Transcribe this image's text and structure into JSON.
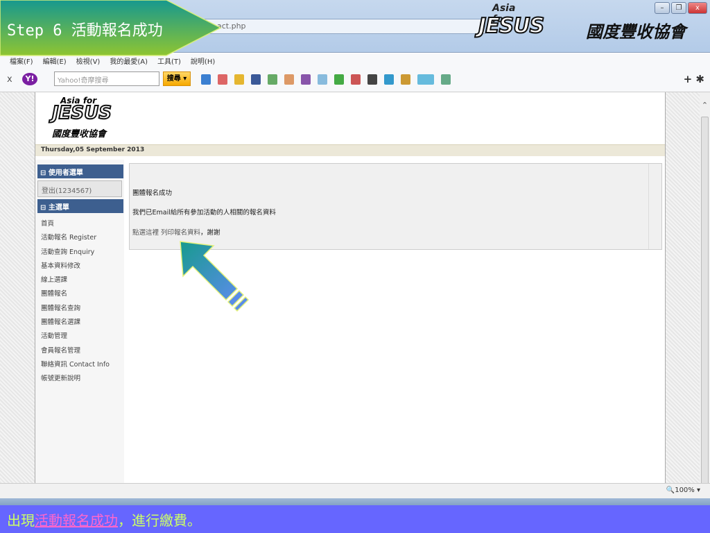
{
  "window": {
    "address": "act.php",
    "brand_top": "Asia for",
    "brand_main": "JESUS",
    "brand_cn": "國度豐收協會",
    "min": "–",
    "restore": "❐",
    "close": "x"
  },
  "menu": [
    "檔案(F)",
    "編輯(E)",
    "檢視(V)",
    "我的最愛(A)",
    "工具(T)",
    "說明(H)"
  ],
  "toolbar": {
    "close": "x",
    "yahoo": "Y!",
    "search_placeholder": "Yahoo!奇摩搜尋",
    "search_button": "搜尋 ▾",
    "right": "+ ✱"
  },
  "page": {
    "logo_top": "Asia for",
    "logo_main": "JESUS",
    "logo_cn": "國度豐收協會",
    "date": "Thursday,05 September 2013",
    "user_menu": "使用者選單",
    "logout": "登出(1234567)",
    "main_menu": "主選單",
    "menu_items": [
      "首頁",
      "活動報名 Register",
      "活動查詢 Enquiry",
      "基本資料修改",
      "線上選課",
      "團體報名",
      "團體報名查詢",
      "團體報名選課",
      "活動管理",
      "會員報名管理",
      "聯絡資訊 Contact Info",
      "帳號更新說明"
    ],
    "success_title": "團體報名成功",
    "email_msg": "我們已Email給所有參加活動的人相關的報名資料",
    "print_prefix": "點選這裡 列印報名資料",
    "print_suffix": "，謝謝"
  },
  "status": {
    "zoom": "100%"
  },
  "banner": {
    "text": "Step 6 活動報名成功"
  },
  "caption": {
    "pre": "出現",
    "highlight": "活動報名成功",
    "post": "，進行繳費。"
  }
}
